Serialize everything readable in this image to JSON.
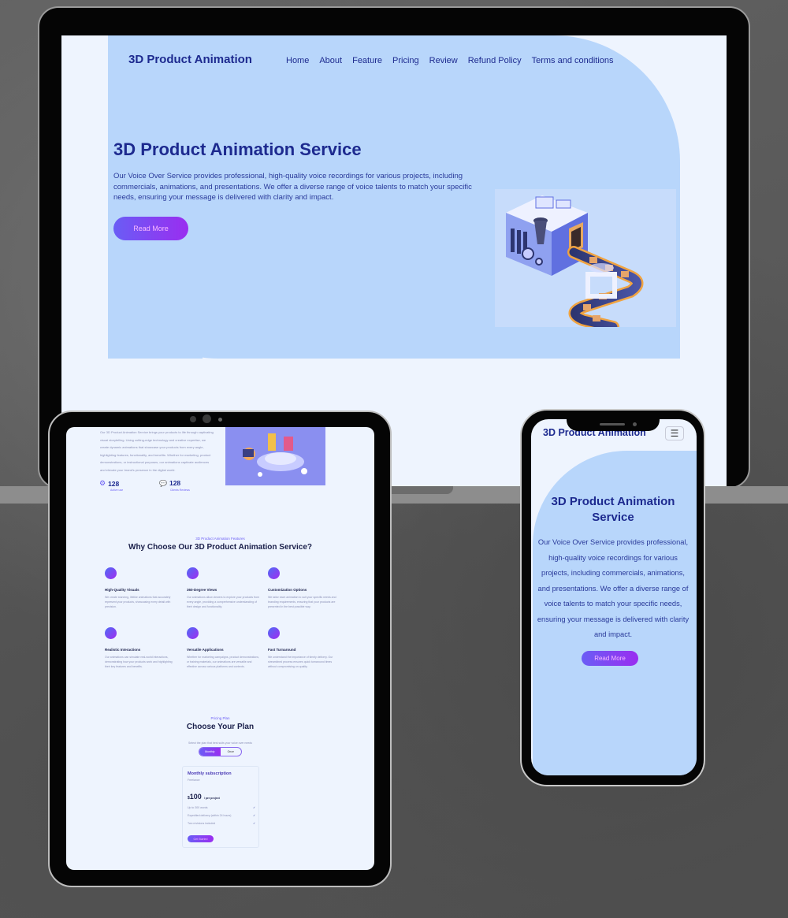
{
  "laptop": {
    "brand": "3D Product Animation",
    "nav": [
      "Home",
      "About",
      "Feature",
      "Pricing",
      "Review",
      "Refund Policy",
      "Terms and conditions"
    ],
    "hero_title": "3D Product Animation Service",
    "hero_description": "Our Voice Over Service provides professional, high-quality voice recordings for various projects, including commercials, animations, and presentations. We offer a diverse range of voice talents to match your specific needs, ensuring your message is delivered with clarity and impact.",
    "cta": "Read More",
    "illustration": "3d-factory-conveyor-illustration"
  },
  "tablet": {
    "about_text": "Our 3D Product Animation Service brings your products to life through captivating visual storytelling. Using cutting-edge technology and creative expertise, we create dynamic animations that showcase your products from every angle, highlighting features, functionality, and benefits. Whether for marketing, product demonstrations, or instructional purposes, our animations captivate audiences and elevate your brand's presence in the digital world.",
    "stats": [
      {
        "value": "128",
        "label": "Active use",
        "icon": "gears-icon"
      },
      {
        "value": "128",
        "label": "Clients Reviews",
        "icon": "chat-icon"
      }
    ],
    "features_eyebrow": "3D Product Animation Features",
    "features_title": "Why Choose Our 3D Product Animation Service?",
    "features": [
      {
        "title": "High-Quality Visuals",
        "desc": "We create stunning, lifelike animations that accurately represent your products, showcasing every detail with precision."
      },
      {
        "title": "360-Degree Views",
        "desc": "Our animations allow viewers to explore your products from every angle, providing a comprehensive understanding of their design and functionality."
      },
      {
        "title": "Customization Options",
        "desc": "We tailor each animation to suit your specific needs and branding requirements, ensuring that your products are presented in the best possible way."
      },
      {
        "title": "Realistic Interactions",
        "desc": "Our animations can simulate real-world interactions, demonstrating how your products work and highlighting their key features and benefits."
      },
      {
        "title": "Versatile Applications",
        "desc": "Whether for marketing campaigns, product demonstrations, or training materials, our animations are versatile and effective across various platforms and contexts."
      },
      {
        "title": "Fast Turnaround",
        "desc": "We understand the importance of timely delivery. Our streamlined process ensures quick turnaround times without compromising on quality."
      }
    ],
    "pricing_eyebrow": "Pricing Plan",
    "pricing_title": "Choose Your Plan",
    "pricing_sub": "Select the plan that best suits your voice over needs",
    "toggle": {
      "active": "Monthly",
      "inactive": "Once"
    },
    "plan": {
      "name": "Monthly subscription",
      "tier": "Freelance",
      "currency": "$",
      "price": "100",
      "period": "/ per project",
      "items": [
        "Up to 300 words",
        "Expedited delivery (within 24 hours)",
        "Two revisions included"
      ],
      "button": "Get Started"
    }
  },
  "phone": {
    "brand": "3D Product Animation",
    "menu_icon": "hamburger-icon",
    "hero_title": "3D Product Animation Service",
    "hero_description": "Our Voice Over Service provides professional, high-quality voice recordings for various projects, including commercials, animations, and presentations. We offer a diverse range of voice talents to match your specific needs, ensuring your message is delivered with clarity and impact.",
    "cta": "Read More"
  },
  "colors": {
    "accent": "#1d2a8f",
    "hero_bg": "#b8d6fb",
    "page_bg": "#eef4fe",
    "gradient_start": "#6a5df5",
    "gradient_end": "#9a2df0"
  }
}
